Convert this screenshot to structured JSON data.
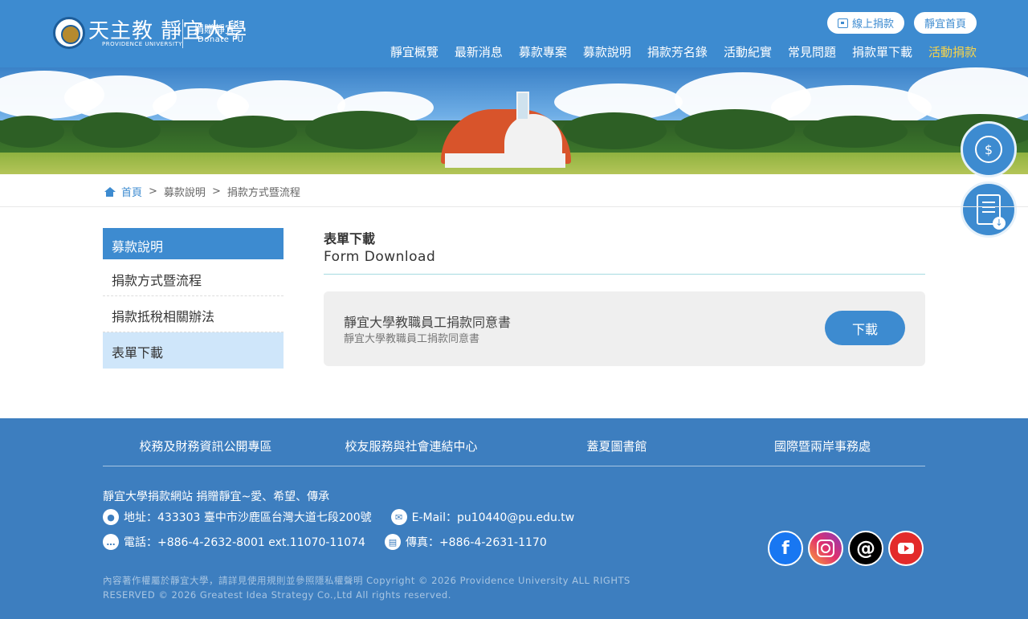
{
  "brand": {
    "name": "天主教 靜宜大學",
    "name_en": "PROVIDENCE UNIVERSITY",
    "site_title": "捐贈靜宜",
    "site_title_en": "Donate PU"
  },
  "top_buttons": {
    "online_donate": "線上捐款",
    "home": "靜宜首頁"
  },
  "nav": [
    {
      "label": "靜宜概覽"
    },
    {
      "label": "最新消息"
    },
    {
      "label": "募款專案"
    },
    {
      "label": "募款說明"
    },
    {
      "label": "捐款芳名錄"
    },
    {
      "label": "活動紀實"
    },
    {
      "label": "常見問題"
    },
    {
      "label": "捐款單下載"
    },
    {
      "label": "活動捐款"
    }
  ],
  "breadcrumb": {
    "home": "首頁",
    "sep": ">",
    "level1": "募款說明",
    "level2": "捐款方式暨流程"
  },
  "sidebar": {
    "heading": "募款說明",
    "items": [
      {
        "label": "捐款方式暨流程"
      },
      {
        "label": "捐款抵稅相關辦法"
      },
      {
        "label": "表單下載"
      }
    ]
  },
  "main": {
    "title": "表單下載",
    "title_en": "Form Download",
    "files": [
      {
        "title": "靜宜大學教職員工捐款同意書",
        "subtitle": "靜宜大學教職員工捐款同意書",
        "button": "下載"
      }
    ]
  },
  "footer": {
    "links": [
      {
        "label": "校務及財務資訊公開專區"
      },
      {
        "label": "校友服務與社會連結中心"
      },
      {
        "label": "蓋夏圖書館"
      },
      {
        "label": "國際暨兩岸事務處"
      }
    ],
    "slogan": "靜宜大學捐款網站 捐贈靜宜~愛、希望、傳承",
    "address": "地址：433303 臺中市沙鹿區台灣大道七段200號",
    "email": "E-Mail：pu10440@pu.edu.tw",
    "phone": "電話：+886-4-2632-8001 ext.11070-11074",
    "fax": "傳真：+886-4-2631-1170",
    "social": [
      "facebook-icon",
      "instagram-icon",
      "threads-icon",
      "youtube-icon"
    ],
    "copyright": "內容著作權屬於靜宜大學，請詳見使用規則並參照隱私權聲明 Copyright © 2026 Providence University ALL RIGHTS RESERVED © 2026 Greatest Idea Strategy Co.,Ltd All rights reserved."
  },
  "colors": {
    "primary": "#3d8bd0",
    "active_nav": "#f7d34a",
    "sidebar_active": "#cfe6fa",
    "footer": "#3d7ebf"
  }
}
